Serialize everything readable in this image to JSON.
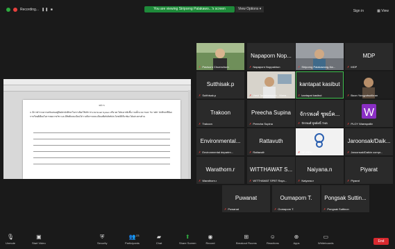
{
  "topbar": {
    "recording_label": "Recording...",
    "viewing_banner": "You are viewing Siriporng Palakawo...'s screen",
    "view_options": "View Options",
    "sign_in": "Sign in",
    "view_label": "View"
  },
  "shared_doc": {
    "page_number": "หน้า 5",
    "paragraph": "3. มีการสำรวจความพร้อมของผู้ถือบัตรนักศึกษาในการเลือกใช้บริการระบบ Smart System หรือ SR ได้สะดวกยิ่งขึ้น รวมทั้งระบบ \"ถอน\" กับ \"หลัก\" นักศึกษาที่มีผลการเรียนดีเยี่ยมในการสอบรายวิชา และมีสิทธิ์ลงทะเบียนได้ รวมถึงการลงทะเบียนเพื่อรับสิทธิประโยชน์ที่เกี่ยวข้อง ได้อย่างครบถ้วน"
  },
  "participants": [
    {
      "center": "",
      "foot": "Pavisorn Chuenchum",
      "active": false,
      "video": "person-green"
    },
    {
      "center": "Napaporn Nop...",
      "foot": "Napaporn Noppakhun",
      "active": false
    },
    {
      "center": "",
      "foot": "Siriporng Palakawong-Na...",
      "active": false,
      "video": "person-room"
    },
    {
      "center": "MDP",
      "foot": "MDP",
      "active": false
    },
    {
      "center": "Sutthisak.p",
      "foot": "Sutthisak.p",
      "active": false
    },
    {
      "center": "",
      "foot": "Vasit Tanasansopin - Mana...",
      "active": false,
      "video": "person-office"
    },
    {
      "center": "kantapat kasibut",
      "foot": "kantapat kasibut",
      "active": true
    },
    {
      "center": "",
      "foot": "Boon Yongyutsutikran",
      "active": false,
      "video": "person-dark"
    },
    {
      "center": "Trakoon",
      "foot": "Trakoon",
      "active": false
    },
    {
      "center": "Preecha Supina",
      "foot": "Preecha Supina",
      "active": false
    },
    {
      "center": "จักรพงศ์ ชูพย์ค...",
      "foot": "จักรพงศ์ ชูพย์คนิ์ TNB",
      "active": false
    },
    {
      "center": "",
      "foot": "PLOY Waewpallin",
      "active": false,
      "video": "w-logo"
    },
    {
      "center": "Environmental...",
      "foot": "Environmental departm...",
      "active": false
    },
    {
      "center": "Rattavuth",
      "foot": "Rattavuth",
      "active": false
    },
    {
      "center": "",
      "foot": "BP-ODU",
      "active": false,
      "video": "odu-logo"
    },
    {
      "center": "Jaroonsak/Daik...",
      "foot": "Jaroonsak/Daikin compr...",
      "active": false
    },
    {
      "center": "Warathorn.r",
      "foot": "Warathorn.r",
      "active": false
    },
    {
      "center": "WITTHAWAT S...",
      "foot": "WITTHAWAT SPBT Rayo...",
      "active": false
    },
    {
      "center": "Naiyana.n",
      "foot": "Naiyana.n",
      "active": false
    },
    {
      "center": "Piyarat",
      "foot": "Piyarat",
      "active": false
    },
    {
      "center": "Puwanat",
      "foot": "Puwanat",
      "active": false
    },
    {
      "center": "Oumaporn T.",
      "foot": "Oumaporn T.",
      "active": false
    },
    {
      "center": "Pongsak Suttin...",
      "foot": "Pongsak Suttinon",
      "active": false
    }
  ],
  "bottombar": {
    "items": [
      {
        "label": "Unmute",
        "icon": "mic-muted-icon"
      },
      {
        "label": "Start Video",
        "icon": "video-off-icon"
      },
      {
        "label": "Security",
        "icon": "shield-icon"
      },
      {
        "label": "Participants",
        "icon": "participants-icon",
        "count": "23"
      },
      {
        "label": "Chat",
        "icon": "chat-icon"
      },
      {
        "label": "Share Screen",
        "icon": "share-screen-icon"
      },
      {
        "label": "Record",
        "icon": "record-icon"
      },
      {
        "label": "Breakout Rooms",
        "icon": "breakout-icon"
      },
      {
        "label": "Reactions",
        "icon": "reactions-icon"
      },
      {
        "label": "Apps",
        "icon": "apps-icon"
      },
      {
        "label": "Whiteboards",
        "icon": "whiteboard-icon"
      }
    ],
    "end_label": "End"
  }
}
